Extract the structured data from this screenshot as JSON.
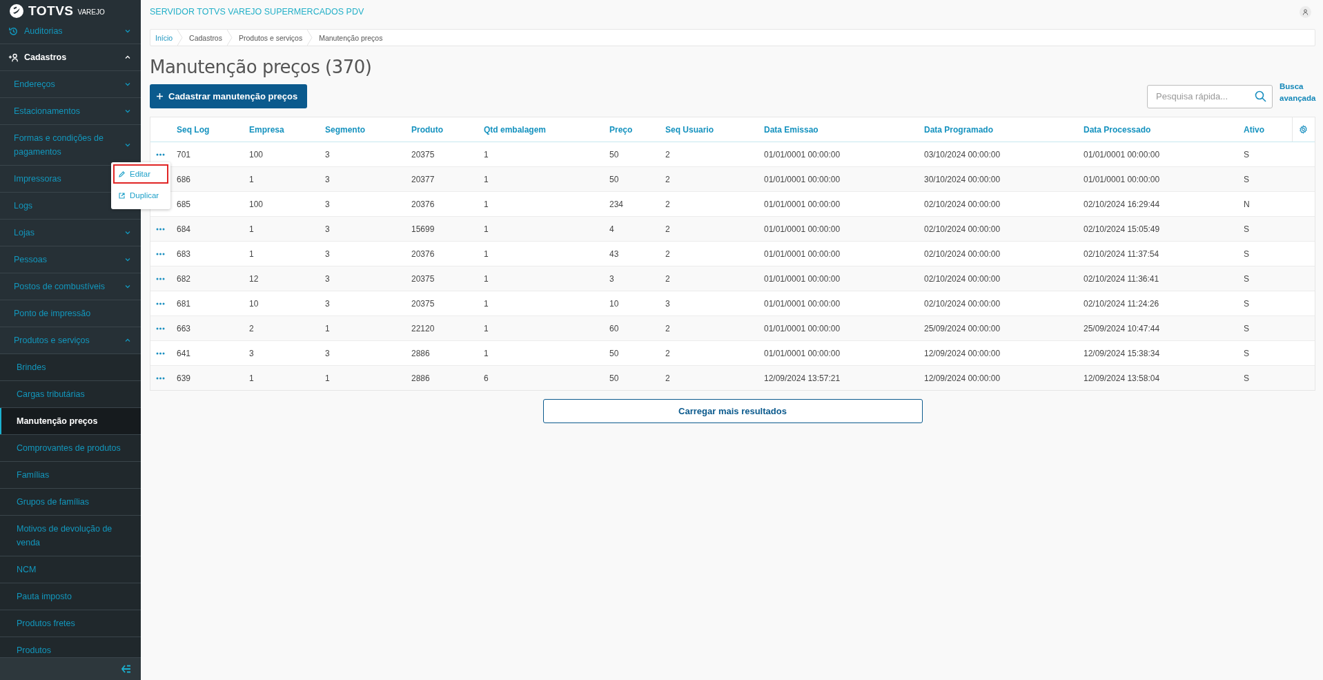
{
  "brand": {
    "name": "TOTVS",
    "product": "VAREJO"
  },
  "sidebar": {
    "items": [
      {
        "label": "Auditorias",
        "kind": "group",
        "expanded": false
      },
      {
        "label": "Cadastros",
        "kind": "group",
        "expanded": true,
        "children": [
          {
            "label": "Endereços",
            "kind": "group",
            "expanded": false
          },
          {
            "label": "Estacionamentos",
            "kind": "group",
            "expanded": false
          },
          {
            "label": "Formas e condições de pagamentos",
            "kind": "group",
            "expanded": false
          },
          {
            "label": "Impressoras",
            "kind": "link",
            "selected": false
          },
          {
            "label": "Logs",
            "kind": "link",
            "selected": false
          },
          {
            "label": "Lojas",
            "kind": "group",
            "expanded": false
          },
          {
            "label": "Pessoas",
            "kind": "group",
            "expanded": false
          },
          {
            "label": "Postos de combustíveis",
            "kind": "group",
            "expanded": false
          },
          {
            "label": "Ponto de impressão",
            "kind": "link",
            "selected": false
          },
          {
            "label": "Produtos e serviços",
            "kind": "group",
            "expanded": true,
            "children": [
              {
                "label": "Brindes",
                "kind": "link",
                "selected": false
              },
              {
                "label": "Cargas tributárias",
                "kind": "link",
                "selected": false
              },
              {
                "label": "Manutenção preços",
                "kind": "link",
                "selected": true
              },
              {
                "label": "Comprovantes de produtos",
                "kind": "link",
                "selected": false
              },
              {
                "label": "Famílias",
                "kind": "link",
                "selected": false
              },
              {
                "label": "Grupos de famílias",
                "kind": "link",
                "selected": false
              },
              {
                "label": "Motivos de devolução de venda",
                "kind": "link",
                "selected": false
              },
              {
                "label": "NCM",
                "kind": "link",
                "selected": false
              },
              {
                "label": "Pauta imposto",
                "kind": "link",
                "selected": false
              },
              {
                "label": "Produtos fretes",
                "kind": "link",
                "selected": false
              },
              {
                "label": "Produtos",
                "kind": "link",
                "selected": false
              }
            ]
          }
        ]
      }
    ]
  },
  "header": {
    "server_title": "SERVIDOR TOTVS VAREJO SUPERMERCADOS PDV"
  },
  "breadcrumb": [
    "Início",
    "Cadastros",
    "Produtos e serviços",
    "Manutenção preços"
  ],
  "page": {
    "title": "Manutenção preços (370)",
    "primary_button": "Cadastrar manutenção preços",
    "search": {
      "placeholder": "Pesquisa rápida..."
    },
    "advanced_search": "Busca avançada"
  },
  "table": {
    "columns": [
      "Seq Log",
      "Empresa",
      "Segmento",
      "Produto",
      "Qtd embalagem",
      "Preço",
      "Seq Usuario",
      "Data Emissao",
      "Data Programado",
      "Data Processado",
      "Ativo"
    ],
    "rows": [
      {
        "cells": [
          "701",
          "100",
          "3",
          "20375",
          "1",
          "50",
          "2",
          "01/01/0001 00:00:00",
          "03/10/2024 00:00:00",
          "01/01/0001 00:00:00",
          "S"
        ],
        "menu": {
          "items": [
            {
              "label": "Editar",
              "focused": true
            },
            {
              "label": "Duplicar",
              "focused": false
            }
          ]
        }
      },
      {
        "cells": [
          "686",
          "1",
          "3",
          "20377",
          "1",
          "50",
          "2",
          "01/01/0001 00:00:00",
          "30/10/2024 00:00:00",
          "01/01/0001 00:00:00",
          "S"
        ]
      },
      {
        "cells": [
          "685",
          "100",
          "3",
          "20376",
          "1",
          "234",
          "2",
          "01/01/0001 00:00:00",
          "02/10/2024 00:00:00",
          "02/10/2024 16:29:44",
          "N"
        ]
      },
      {
        "cells": [
          "684",
          "1",
          "3",
          "15699",
          "1",
          "4",
          "2",
          "01/01/0001 00:00:00",
          "02/10/2024 00:00:00",
          "02/10/2024 15:05:49",
          "S"
        ]
      },
      {
        "cells": [
          "683",
          "1",
          "3",
          "20376",
          "1",
          "43",
          "2",
          "01/01/0001 00:00:00",
          "02/10/2024 00:00:00",
          "02/10/2024 11:37:54",
          "S"
        ]
      },
      {
        "cells": [
          "682",
          "12",
          "3",
          "20375",
          "1",
          "3",
          "2",
          "01/01/0001 00:00:00",
          "02/10/2024 00:00:00",
          "02/10/2024 11:36:41",
          "S"
        ]
      },
      {
        "cells": [
          "681",
          "10",
          "3",
          "20375",
          "1",
          "10",
          "3",
          "01/01/0001 00:00:00",
          "02/10/2024 00:00:00",
          "02/10/2024 11:24:26",
          "S"
        ]
      },
      {
        "cells": [
          "663",
          "2",
          "1",
          "22120",
          "1",
          "60",
          "2",
          "01/01/0001 00:00:00",
          "25/09/2024 00:00:00",
          "25/09/2024 10:47:44",
          "S"
        ]
      },
      {
        "cells": [
          "641",
          "3",
          "3",
          "2886",
          "1",
          "50",
          "2",
          "01/01/0001 00:00:00",
          "12/09/2024 00:00:00",
          "12/09/2024 15:38:34",
          "S"
        ]
      },
      {
        "cells": [
          "639",
          "1",
          "1",
          "2886",
          "6",
          "50",
          "2",
          "12/09/2024 13:57:21",
          "12/09/2024 00:00:00",
          "12/09/2024 13:58:04",
          "S"
        ]
      }
    ],
    "load_more": "Carregar mais resultados"
  }
}
